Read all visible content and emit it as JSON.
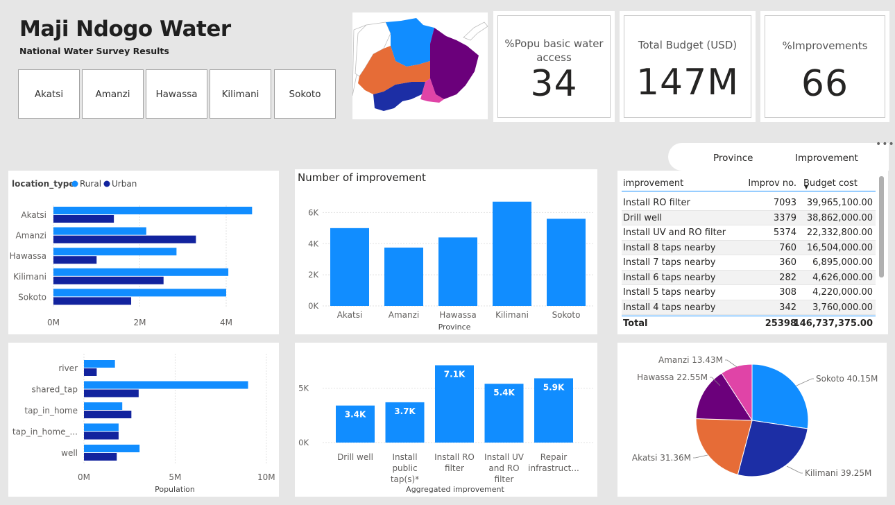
{
  "header": {
    "title": "Maji Ndogo Water",
    "subtitle": "National Water Survey Results",
    "slicers": [
      "Akatsi",
      "Amanzi",
      "Hawassa",
      "Kilimani",
      "Sokoto"
    ]
  },
  "kpis": [
    {
      "label_line1": "%Popu basic water",
      "label_line2": "access",
      "value": "34"
    },
    {
      "label_line1": "Total Budget (USD)",
      "label_line2": "",
      "value": "147M"
    },
    {
      "label_line1": "%Improvements",
      "label_line2": "",
      "value": "66"
    }
  ],
  "colors": {
    "rural": "#118dff",
    "urban": "#12239e",
    "bar": "#118dff",
    "akatsi": "#e66c37",
    "kilimani": "#1c2ea5",
    "sokoto": "#118dff",
    "hawassa": "#6b007b",
    "amanzi": "#e044a7"
  },
  "toggle": {
    "province": "Province",
    "improvement": "Improvement"
  },
  "more_icon": "more-options-icon",
  "table": {
    "headers": [
      "improvement",
      "Improv no.",
      "Budget cost"
    ],
    "rows": [
      [
        "Install RO filter",
        "7093",
        "39,965,100.00"
      ],
      [
        "Drill well",
        "3379",
        "38,862,000.00"
      ],
      [
        "Install UV and RO filter",
        "5374",
        "22,332,800.00"
      ],
      [
        "Install 8 taps nearby",
        "760",
        "16,504,000.00"
      ],
      [
        "Install 7 taps nearby",
        "360",
        "6,895,000.00"
      ],
      [
        "Install 6 taps nearby",
        "282",
        "4,626,000.00"
      ],
      [
        "Install 5 taps nearby",
        "308",
        "4,220,000.00"
      ],
      [
        "Install 4 taps nearby",
        "342",
        "3,760,000.00"
      ]
    ],
    "total": [
      "Total",
      "25398",
      "146,737,375.00"
    ]
  },
  "chart_data": [
    {
      "type": "bar",
      "orientation": "horizontal",
      "legend_title": "location_type",
      "categories": [
        "Akatsi",
        "Amanzi",
        "Hawassa",
        "Kilimani",
        "Sokoto"
      ],
      "series": [
        {
          "name": "Rural",
          "values": [
            4.6,
            2.15,
            2.85,
            4.05,
            4.0
          ]
        },
        {
          "name": "Urban",
          "values": [
            1.4,
            3.3,
            1.0,
            2.55,
            1.8
          ]
        }
      ],
      "xticks": [
        "0M",
        "2M",
        "4M"
      ],
      "xlim": [
        0,
        4.9
      ]
    },
    {
      "type": "bar",
      "title": "Number of improvement",
      "xlabel": "Province",
      "categories": [
        "Akatsi",
        "Amanzi",
        "Hawassa",
        "Kilimani",
        "Sokoto"
      ],
      "values": [
        5000,
        3750,
        4400,
        6700,
        5600
      ],
      "yticks": [
        "0K",
        "2K",
        "4K",
        "6K"
      ],
      "ylim": [
        0,
        7000
      ]
    },
    {
      "type": "bar",
      "orientation": "horizontal",
      "xlabel": "Population",
      "categories": [
        "river",
        "shared_tap",
        "tap_in_home",
        "tap_in_home_...",
        "well"
      ],
      "series": [
        {
          "name": "Rural",
          "values": [
            1.7,
            9.0,
            2.1,
            1.9,
            3.05
          ]
        },
        {
          "name": "Urban",
          "values": [
            0.7,
            3.0,
            2.6,
            1.9,
            1.8
          ]
        }
      ],
      "xticks": [
        "0M",
        "5M",
        "10M"
      ],
      "xlim": [
        0,
        10.5
      ]
    },
    {
      "type": "bar",
      "xlabel": "Aggregated improvement",
      "categories": [
        "Drill well",
        "Install public tap(s)*",
        "Install RO filter",
        "Install UV and RO filter",
        "Repair infrastruct..."
      ],
      "category_lines": [
        [
          "Drill well"
        ],
        [
          "Install",
          "public",
          "tap(s)*"
        ],
        [
          "Install RO",
          "filter"
        ],
        [
          "Install UV",
          "and RO",
          "filter"
        ],
        [
          "Repair",
          "infrastruct..."
        ]
      ],
      "values": [
        3400,
        3700,
        7100,
        5400,
        5900
      ],
      "data_labels": [
        "3.4K",
        "3.7K",
        "7.1K",
        "5.4K",
        "5.9K"
      ],
      "yticks": [
        "0K",
        "5K"
      ],
      "ylim": [
        0,
        7900
      ]
    },
    {
      "type": "pie",
      "slices": [
        {
          "name": "Sokoto",
          "value": 40.15,
          "label": "Sokoto 40.15M"
        },
        {
          "name": "Kilimani",
          "value": 39.25,
          "label": "Kilimani 39.25M"
        },
        {
          "name": "Akatsi",
          "value": 31.36,
          "label": "Akatsi 31.36M"
        },
        {
          "name": "Hawassa",
          "value": 22.55,
          "label": "Hawassa 22.55M"
        },
        {
          "name": "Amanzi",
          "value": 13.43,
          "label": "Amanzi 13.43M"
        }
      ]
    }
  ]
}
